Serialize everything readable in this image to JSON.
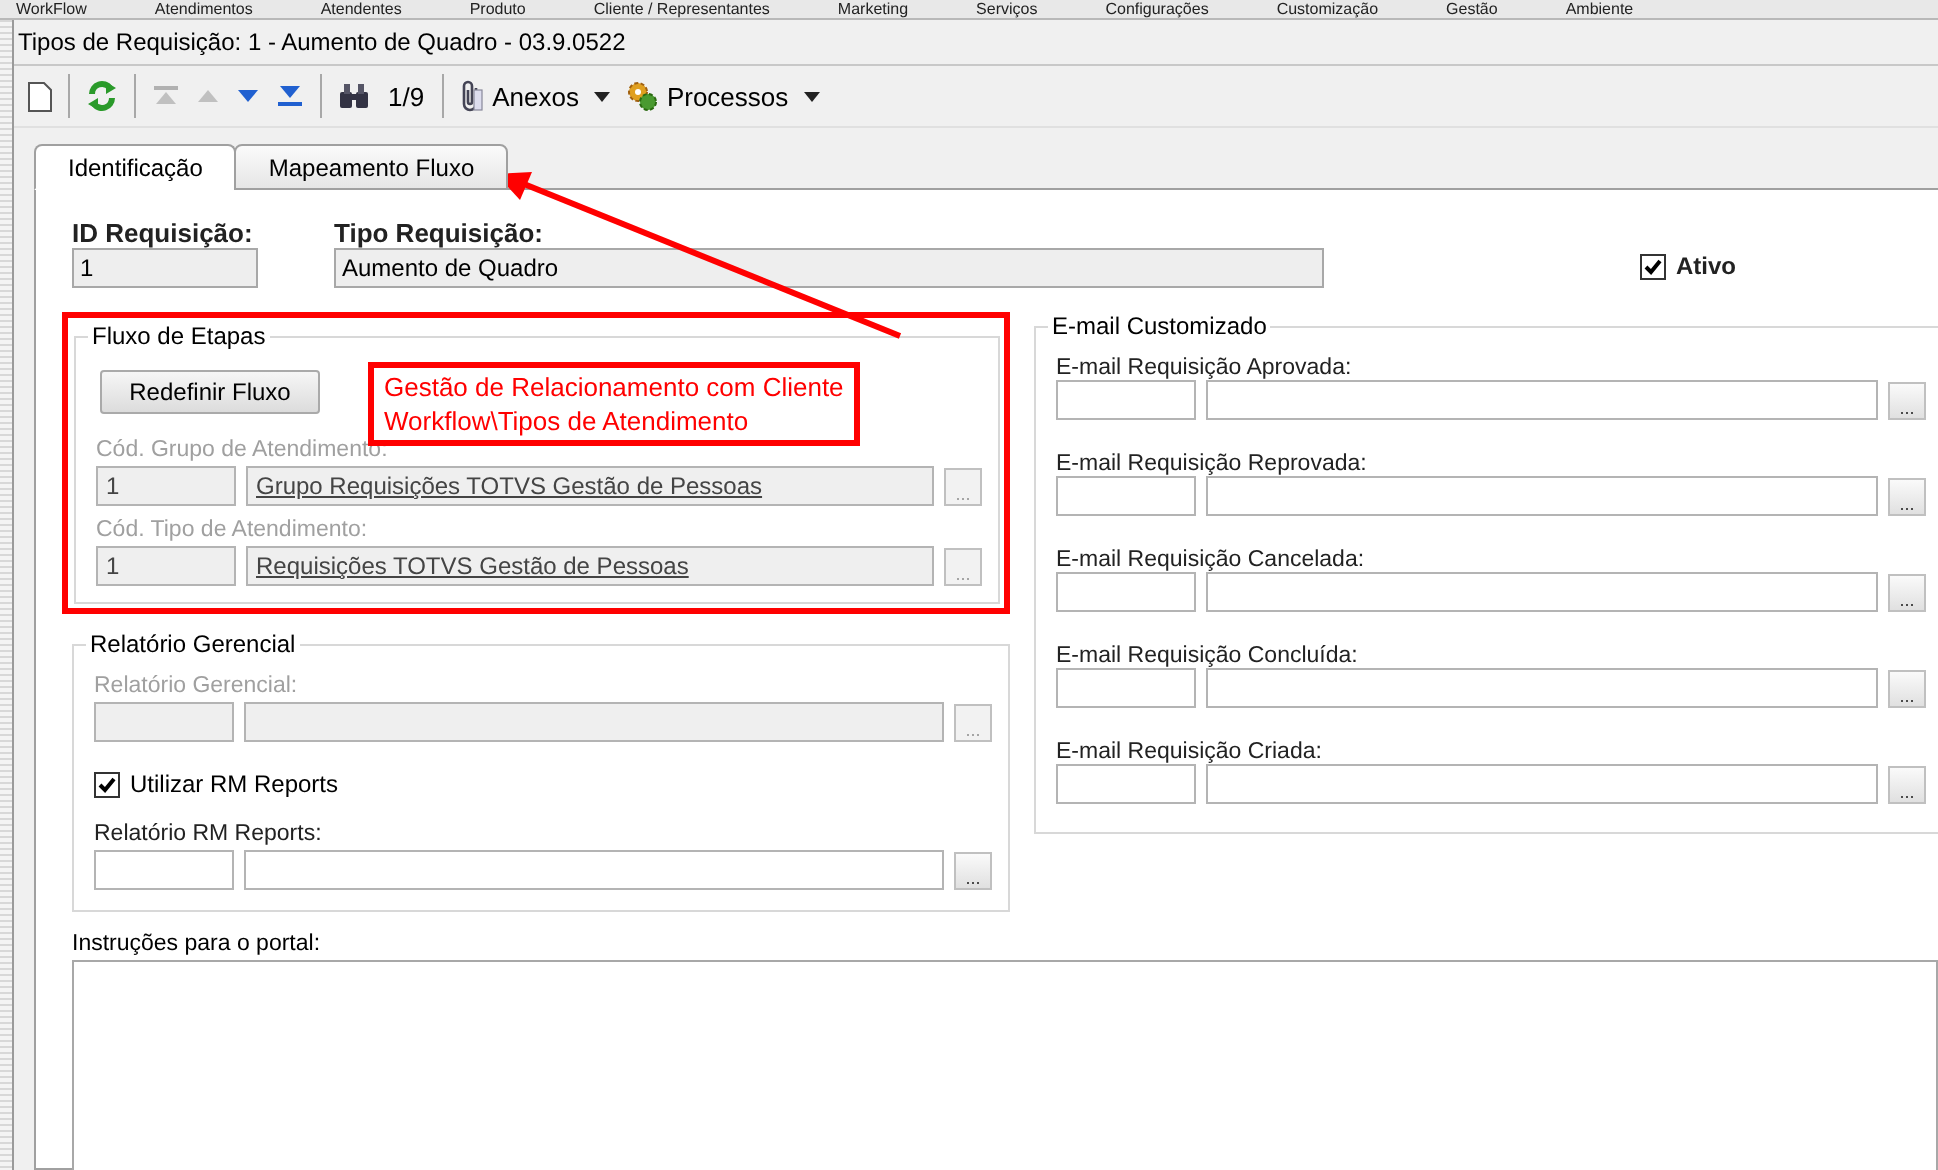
{
  "menu": {
    "items": [
      "WorkFlow",
      "Atendimentos",
      "Atendentes",
      "Produto",
      "Cliente / Representantes",
      "Marketing",
      "Serviços",
      "Configurações",
      "Customização",
      "Gestão",
      "Ambiente"
    ]
  },
  "window": {
    "title": "Tipos de Requisição: 1 - Aumento de Quadro - 03.9.0522"
  },
  "toolbar": {
    "buttons": [
      {
        "kind": "new",
        "disabled": false
      },
      {
        "kind": "refresh",
        "disabled": false
      },
      {
        "kind": "first",
        "disabled": true
      },
      {
        "kind": "previous",
        "disabled": true
      },
      {
        "kind": "next",
        "disabled": false
      },
      {
        "kind": "last",
        "disabled": false
      },
      {
        "kind": "find",
        "disabled": false
      }
    ],
    "counter": "1/9",
    "menus": [
      {
        "kind": "attach",
        "label": "Anexos"
      },
      {
        "kind": "process",
        "label": "Processos"
      }
    ]
  },
  "tabs": [
    {
      "label": "Identificação",
      "selected": true
    },
    {
      "label": "Mapeamento Fluxo",
      "selected": false
    }
  ],
  "id_field": {
    "label": "ID Requisição:",
    "value": "1"
  },
  "type_field": {
    "label": "Tipo Requisição:",
    "value": "Aumento de Quadro"
  },
  "active": {
    "label": "Ativo",
    "checked": true
  },
  "flow": {
    "title": "Fluxo de Etapas",
    "button": "Redefinir Fluxo",
    "lookups": [
      {
        "label": "Cód. Grupo de Atendimento:",
        "code": "1",
        "value": "Grupo Requisições TOTVS Gestão de Pessoas",
        "button": "...",
        "disabled": true
      },
      {
        "label": "Cód. Tipo de Atendimento:",
        "code": "1",
        "value": "Requisições TOTVS Gestão de Pessoas",
        "button": "...",
        "disabled": true
      }
    ]
  },
  "annotation": {
    "lines": [
      "Gestão de Relacionamento com Cliente",
      "Workflow\\Tipos de Atendimento"
    ]
  },
  "report": {
    "title": "Relatório Gerencial",
    "lookup": {
      "label": "Relatório Gerencial:",
      "button": "...",
      "disabled": true
    },
    "checkbox": {
      "label": "Utilizar RM Reports",
      "checked": true
    },
    "rm_lookup": {
      "label": "Relatório RM Reports:",
      "button": "...",
      "disabled": false
    }
  },
  "email": {
    "title": "E-mail Customizado",
    "fields": [
      {
        "label": "E-mail Requisição Aprovada:",
        "button": "...",
        "disabled": false
      },
      {
        "label": "E-mail Requisição Reprovada:",
        "button": "...",
        "disabled": false
      },
      {
        "label": "E-mail Requisição Cancelada:",
        "button": "...",
        "disabled": false
      },
      {
        "label": "E-mail Requisição Concluída:",
        "button": "...",
        "disabled": false
      },
      {
        "label": "E-mail Requisição Criada:",
        "button": "...",
        "disabled": false
      }
    ]
  },
  "instructions": {
    "label": "Instruções para o portal:"
  }
}
